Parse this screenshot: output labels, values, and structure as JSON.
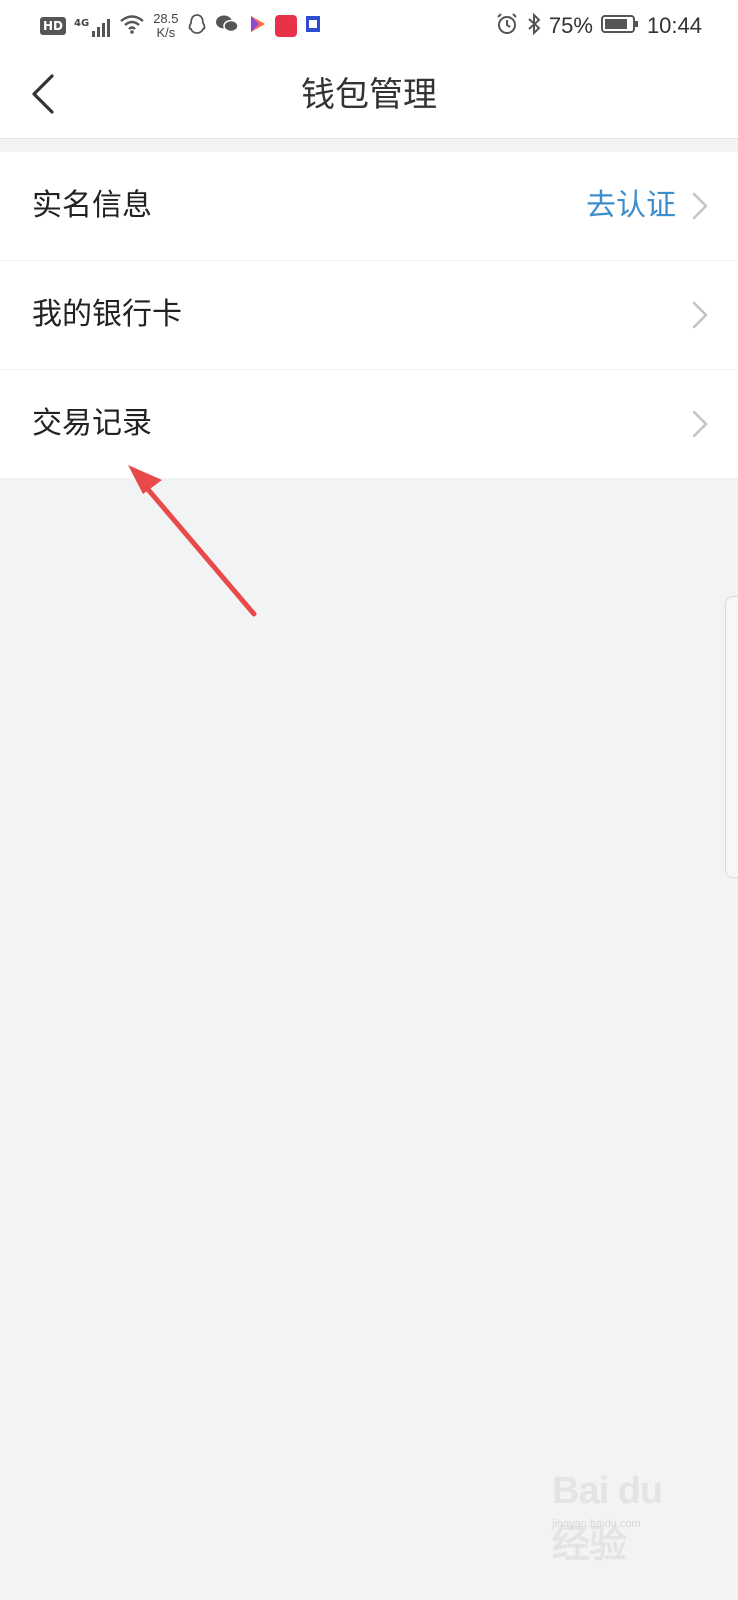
{
  "status_bar": {
    "hd": "HD",
    "network": "4G",
    "speed_value": "28.5",
    "speed_unit": "K/s",
    "battery": "75%",
    "time": "10:44"
  },
  "nav": {
    "title": "钱包管理"
  },
  "menu": {
    "items": [
      {
        "label": "实名信息",
        "value": "去认证"
      },
      {
        "label": "我的银行卡",
        "value": ""
      },
      {
        "label": "交易记录",
        "value": ""
      }
    ]
  },
  "watermark": {
    "logo": "Bai du 经验",
    "url": "jingyan.baidu.com"
  },
  "colors": {
    "accent": "#3d8fcc",
    "arrow": "#e84a4a",
    "background": "#f2f3f5"
  }
}
